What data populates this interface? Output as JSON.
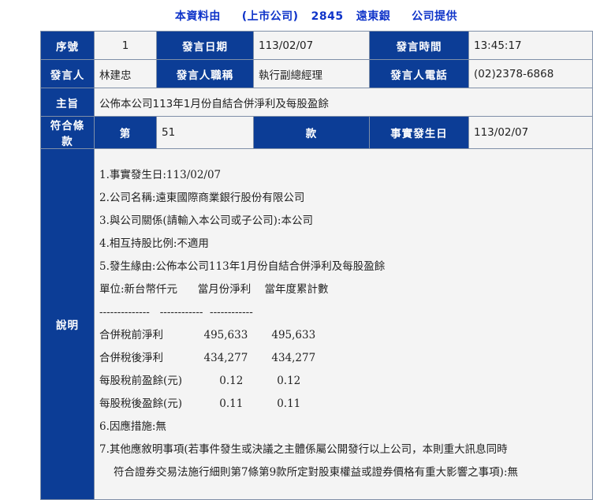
{
  "header": {
    "prefix": "本資料由",
    "company_type": "(上市公司)",
    "company_code": "2845",
    "company_name": "遠東銀",
    "suffix": "公司提供"
  },
  "labels": {
    "serial_no": "序號",
    "speak_date": "發言日期",
    "speak_time": "發言時間",
    "speaker": "發言人",
    "speaker_title": "發言人職稱",
    "speaker_phone": "發言人電話",
    "subject": "主旨",
    "clause": "符合條款",
    "clause_prefix": "第",
    "clause_suffix": "款",
    "event_date": "事實發生日",
    "description": "說明"
  },
  "values": {
    "serial_no": "1",
    "speak_date": "113/02/07",
    "speak_time": "13:45:17",
    "speaker": "林建忠",
    "speaker_title": "執行副總經理",
    "speaker_phone": "(02)2378-6868",
    "subject": "公佈本公司113年1月份自結合併淨利及每股盈餘",
    "clause_no": "51",
    "event_date": "113/02/07"
  },
  "description_lines": [
    "1.事實發生日:113/02/07",
    "2.公司名稱:遠東國際商業銀行股份有限公司",
    "3.與公司關係(請輸入本公司或子公司):本公司",
    "4.相互持股比例:不適用",
    "5.發生緣由:公佈本公司113年1月份自結合併淨利及每股盈餘",
    "單位:新台幣仟元      當月份淨利    當年度累計數",
    "--------------   ------------  ------------",
    "合併稅前淨利            495,633       495,633",
    "合併稅後淨利            434,277       434,277",
    "每股稅前盈餘(元)           0.12          0.12",
    "每股稅後盈餘(元)           0.11          0.11",
    "6.因應措施:無",
    "7.其他應敘明事項(若事件發生或決議之主體係屬公開發行以上公司，本則重大訊息同時",
    "符合證券交易法施行細則第7條第9款所定對股東權益或證券價格有重大影響之事項):無"
  ]
}
